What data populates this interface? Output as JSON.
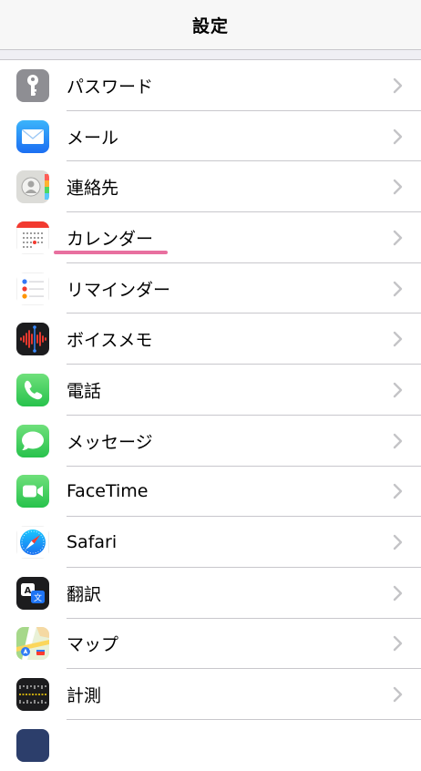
{
  "navbar": {
    "title": "設定"
  },
  "rows": [
    {
      "label": "パスワード"
    },
    {
      "label": "メール"
    },
    {
      "label": "連絡先"
    },
    {
      "label": "カレンダー"
    },
    {
      "label": "リマインダー"
    },
    {
      "label": "ボイスメモ"
    },
    {
      "label": "電話"
    },
    {
      "label": "メッセージ"
    },
    {
      "label": "FaceTime"
    },
    {
      "label": "Safari"
    },
    {
      "label": "翻訳"
    },
    {
      "label": "マップ"
    },
    {
      "label": "計測"
    }
  ],
  "colors": {
    "accent_underline": "#e8709f",
    "chevron": "#c4c4c7"
  },
  "icons": [
    "key-icon",
    "mail-icon",
    "contacts-icon",
    "calendar-icon",
    "reminders-icon",
    "voice-memos-icon",
    "phone-icon",
    "messages-icon",
    "facetime-icon",
    "safari-icon",
    "translate-icon",
    "maps-icon",
    "measure-icon"
  ]
}
